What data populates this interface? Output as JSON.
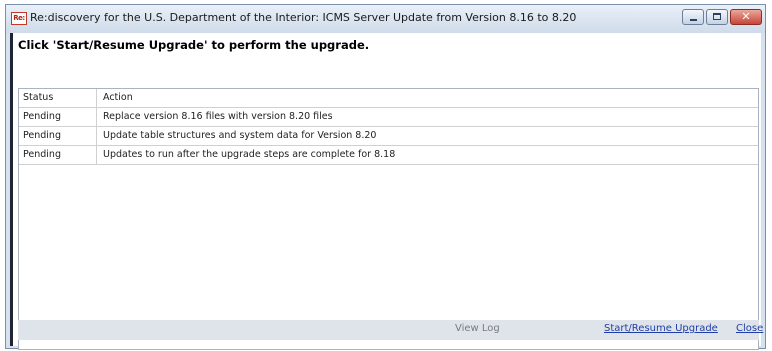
{
  "window": {
    "app_icon_text": "Re:",
    "title": "Re:discovery for the U.S. Department of the Interior: ICMS Server Update from Version 8.16 to 8.20",
    "controls": {
      "minimize": "minimize-icon",
      "maximize": "maximize-icon",
      "close": "close-icon",
      "close_glyph": "✕"
    }
  },
  "instruction": "Click 'Start/Resume Upgrade' to perform the upgrade.",
  "table": {
    "columns": [
      "Status",
      "Action"
    ],
    "rows": [
      {
        "status": "Pending",
        "action": "Replace version 8.16 files with version 8.20 files"
      },
      {
        "status": "Pending",
        "action": "Update table structures and system data for Version 8.20"
      },
      {
        "status": "Pending",
        "action": "Updates to run after the upgrade steps are complete for 8.18"
      }
    ]
  },
  "footer": {
    "view_log": "View Log",
    "start_resume": "Start/Resume Upgrade",
    "close": "Close"
  },
  "colors": {
    "link": "#1f3ea8",
    "disabled": "#7a7a7a",
    "close_button": "#c8453a"
  }
}
